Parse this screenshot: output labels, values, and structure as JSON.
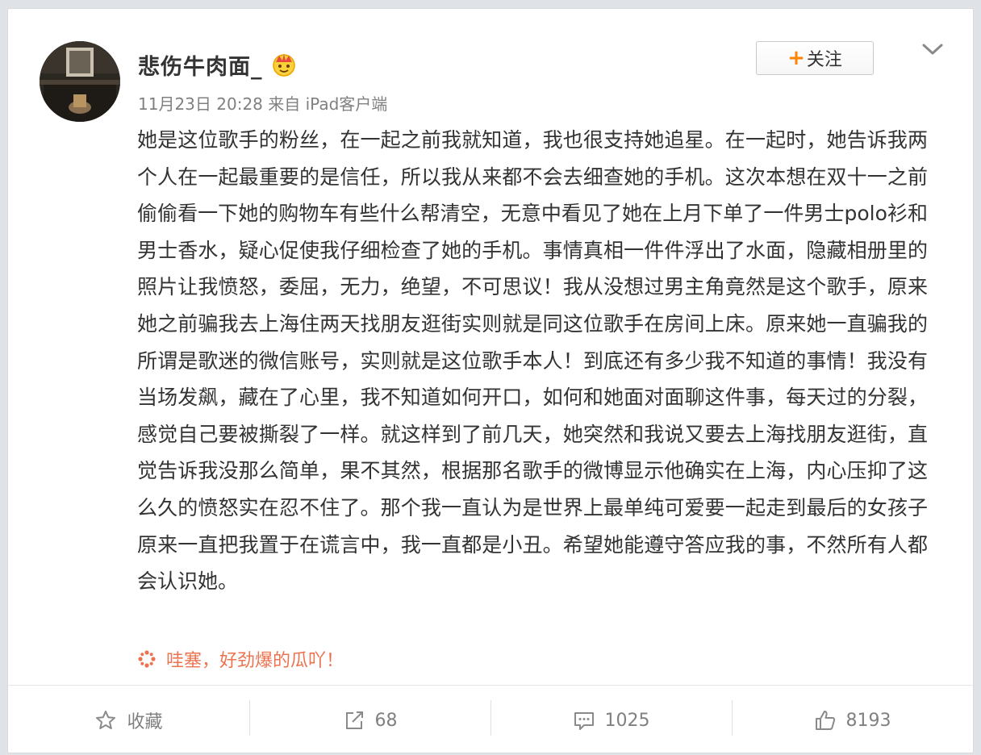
{
  "post": {
    "username": "悲伤牛肉面_",
    "meta": "11月23日 20:28 来自 iPad客户端",
    "follow_label": "关注",
    "text": "她是这位歌手的粉丝，在一起之前我就知道，我也很支持她追星。在一起时，她告诉我两个人在一起最重要的是信任，所以我从来都不会去细查她的手机。这次本想在双十一之前偷偷看一下她的购物车有些什么帮清空，无意中看见了她在上月下单了一件男士polo衫和男士香水，疑心促使我仔细检查了她的手机。事情真相一件件浮出了水面，隐藏相册里的照片让我愤怒，委屈，无力，绝望，不可思议！我从没想过男主角竟然是这个歌手，原来她之前骗我去上海住两天找朋友逛街实则就是同这位歌手在房间上床。原来她一直骗我的所谓是歌迷的微信账号，实则就是这位歌手本人！到底还有多少我不知道的事情！我没有当场发飙，藏在了心里，我不知道如何开口，如何和她面对面聊这件事，每天过的分裂，感觉自己要被撕裂了一样。就这样到了前几天，她突然和我说又要去上海找朋友逛街，直觉告诉我没那么简单，果不其然，根据那名歌手的微博显示他确实在上海，内心压抑了这么久的愤怒实在忍不住了。那个我一直认为是世界上最单纯可爱要一起走到最后的女孩子原来一直把我置于在谎言中，我一直都是小丑。希望她能遵守答应我的事，不然所有人都会认识她。",
    "reaction": "哇塞，好劲爆的瓜吖！"
  },
  "footer": {
    "favorite_label": "收藏",
    "repost_count": "68",
    "comment_count": "1025",
    "like_count": "8193"
  },
  "colors": {
    "accent_orange": "#ff8200",
    "reaction_color": "#eb7350",
    "text_main": "#333333",
    "text_muted": "#808080"
  },
  "icons": {
    "avatar": "avatar",
    "verified": "crown-icon",
    "menu": "chevron-down-icon",
    "reaction": "spark-icon",
    "favorite": "star-icon",
    "repost": "repost-icon",
    "comment": "comment-icon",
    "like": "thumbs-up-icon"
  }
}
